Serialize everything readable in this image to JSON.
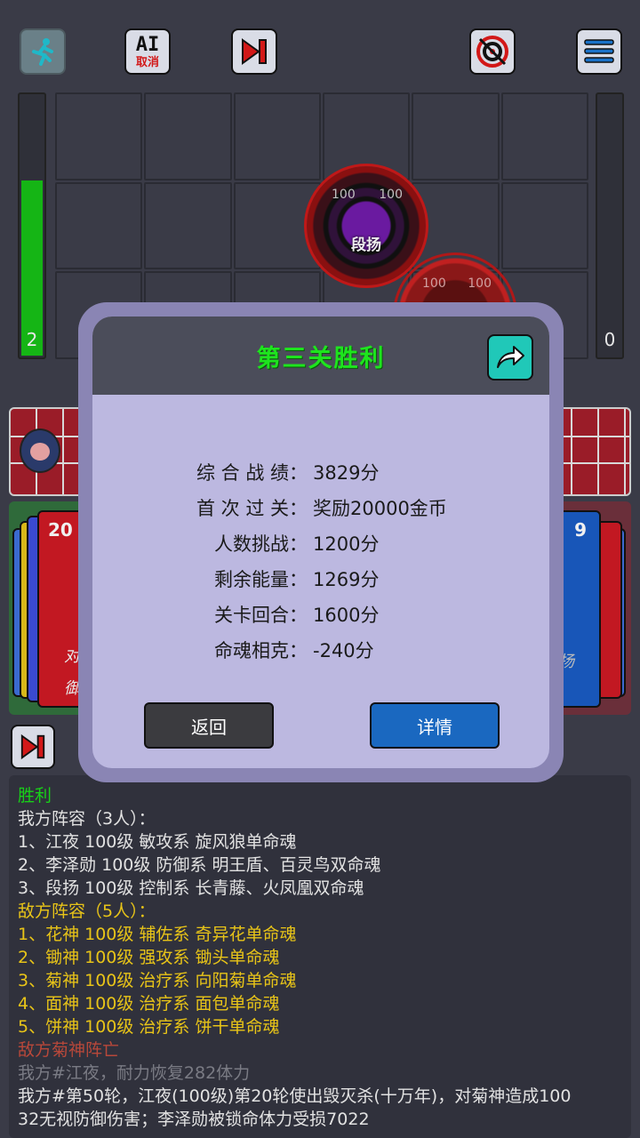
{
  "toolbar": {
    "ai_line1": "AI",
    "ai_line2": "取消",
    "icons": [
      "running-man-icon",
      "skip-turn-icon",
      "target-icon",
      "menu-icon"
    ],
    "colors": {
      "active_icon": "#d21818",
      "menu_icon": "#1a72c8"
    }
  },
  "board": {
    "left_energy": "2",
    "left_energy_level": 0.7,
    "right_energy": "0",
    "right_energy_level": 0,
    "unit1": {
      "name": "段扬",
      "hp_left": "100",
      "hp_right": "100"
    },
    "unit2": {
      "hp_left": "100",
      "hp_right": "100"
    }
  },
  "decks": {
    "left_count": "20",
    "left_text1": "对",
    "left_text2": "御",
    "right_count": "9",
    "right_text": "扬"
  },
  "dialog": {
    "title": "第三关胜利",
    "stats": [
      {
        "label": "综 合 战 绩：",
        "value": "3829分"
      },
      {
        "label": "首 次 过 关：",
        "value": "奖励20000金币"
      },
      {
        "label": "人数挑战：",
        "value": "1200分"
      },
      {
        "label": "剩余能量：",
        "value": "1269分"
      },
      {
        "label": "关卡回合：",
        "value": "1600分"
      },
      {
        "label": "命魂相克：",
        "value": "-240分"
      }
    ],
    "back_label": "返回",
    "detail_label": "详情"
  },
  "log": {
    "lines": [
      {
        "text": "胜利",
        "color": "green"
      },
      {
        "text": "我方阵容（3人）：",
        "color": "white"
      },
      {
        "text": "1、江夜 100级 敏攻系 旋风狼单命魂",
        "color": "white"
      },
      {
        "text": "2、李泽勋 100级 防御系 明王盾、百灵鸟双命魂",
        "color": "white"
      },
      {
        "text": "3、段扬 100级 控制系 长青藤、火凤凰双命魂",
        "color": "white"
      },
      {
        "text": "敌方阵容（5人）：",
        "color": "yellow"
      },
      {
        "text": "1、花神 100级 辅佐系 奇异花单命魂",
        "color": "yellow"
      },
      {
        "text": "2、锄神 100级 强攻系 锄头单命魂",
        "color": "yellow"
      },
      {
        "text": "3、菊神 100级 治疗系 向阳菊单命魂",
        "color": "yellow"
      },
      {
        "text": "4、面神 100级 治疗系 面包单命魂",
        "color": "yellow"
      },
      {
        "text": "5、饼神 100级 治疗系 饼干单命魂",
        "color": "yellow"
      },
      {
        "text": "敌方菊神阵亡",
        "color": "red"
      },
      {
        "text": "我方#江夜，耐力恢复282体力",
        "color": "grey"
      },
      {
        "text": "我方#第50轮，江夜(100级)第20轮使出毁灭杀(十万年)，对菊神造成100",
        "color": "white"
      },
      {
        "text": "32无视防御伤害；李泽勋被锁命体力受损7022",
        "color": "white"
      }
    ]
  }
}
